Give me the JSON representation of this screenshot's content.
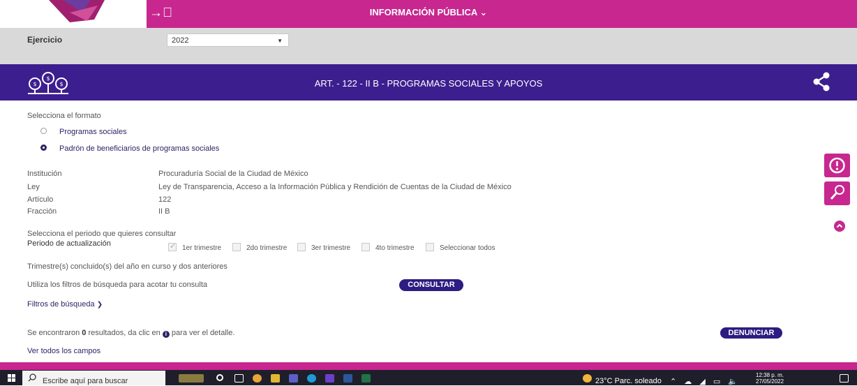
{
  "header": {
    "menu_title": "INFORMACIÓN PÚBLICA ⌄"
  },
  "exercise": {
    "label": "Ejercicio",
    "value": "2022"
  },
  "article": {
    "title": "ART. - 122 - II B - PROGRAMAS SOCIALES Y APOYOS"
  },
  "format": {
    "prompt": "Selecciona el formato",
    "options": [
      {
        "label": "Programas sociales",
        "selected": false
      },
      {
        "label": "Padrón de beneficiarios de programas sociales",
        "selected": true
      }
    ]
  },
  "info": [
    {
      "key": "Institución",
      "value": "Procuraduría Social de la Ciudad de México"
    },
    {
      "key": "Ley",
      "value": "Ley de Transparencia, Acceso a la Información Pública y Rendición de Cuentas de la Ciudad de México"
    },
    {
      "key": "Artículo",
      "value": "122"
    },
    {
      "key": "Fracción",
      "value": "II B"
    }
  ],
  "period": {
    "prompt": "Selecciona el periodo que quieres consultar",
    "label": "Periodo de actualización",
    "options": [
      {
        "label": "1er trimestre",
        "checked": true
      },
      {
        "label": "2do trimestre",
        "checked": false
      },
      {
        "label": "3er trimestre",
        "checked": false
      },
      {
        "label": "4to trimestre",
        "checked": false
      },
      {
        "label": "Seleccionar todos",
        "checked": false
      }
    ],
    "note": "Trimestre(s) concluido(s) del año en curso y dos anteriores"
  },
  "filters": {
    "hint": "Utiliza los filtros de búsqueda para acotar tu consulta",
    "consult_button": "CONSULTAR",
    "toggle": "Filtros de búsqueda"
  },
  "results": {
    "prefix": "Se encontraron ",
    "count": "0",
    "middle": " resultados, da clic en ",
    "suffix": " para ver el detalle.",
    "denounce_button": "DENUNCIAR",
    "all_fields_link": "Ver todos los campos"
  },
  "taskbar": {
    "search_placeholder": "Escribe aquí para buscar",
    "weather": "23°C  Parc. soleado",
    "time": "12:38 p. m.",
    "date": "27/05/2022"
  },
  "colors": {
    "magenta": "#c7278f",
    "purple": "#3d1e8f",
    "navy_button": "#2d1c82"
  }
}
